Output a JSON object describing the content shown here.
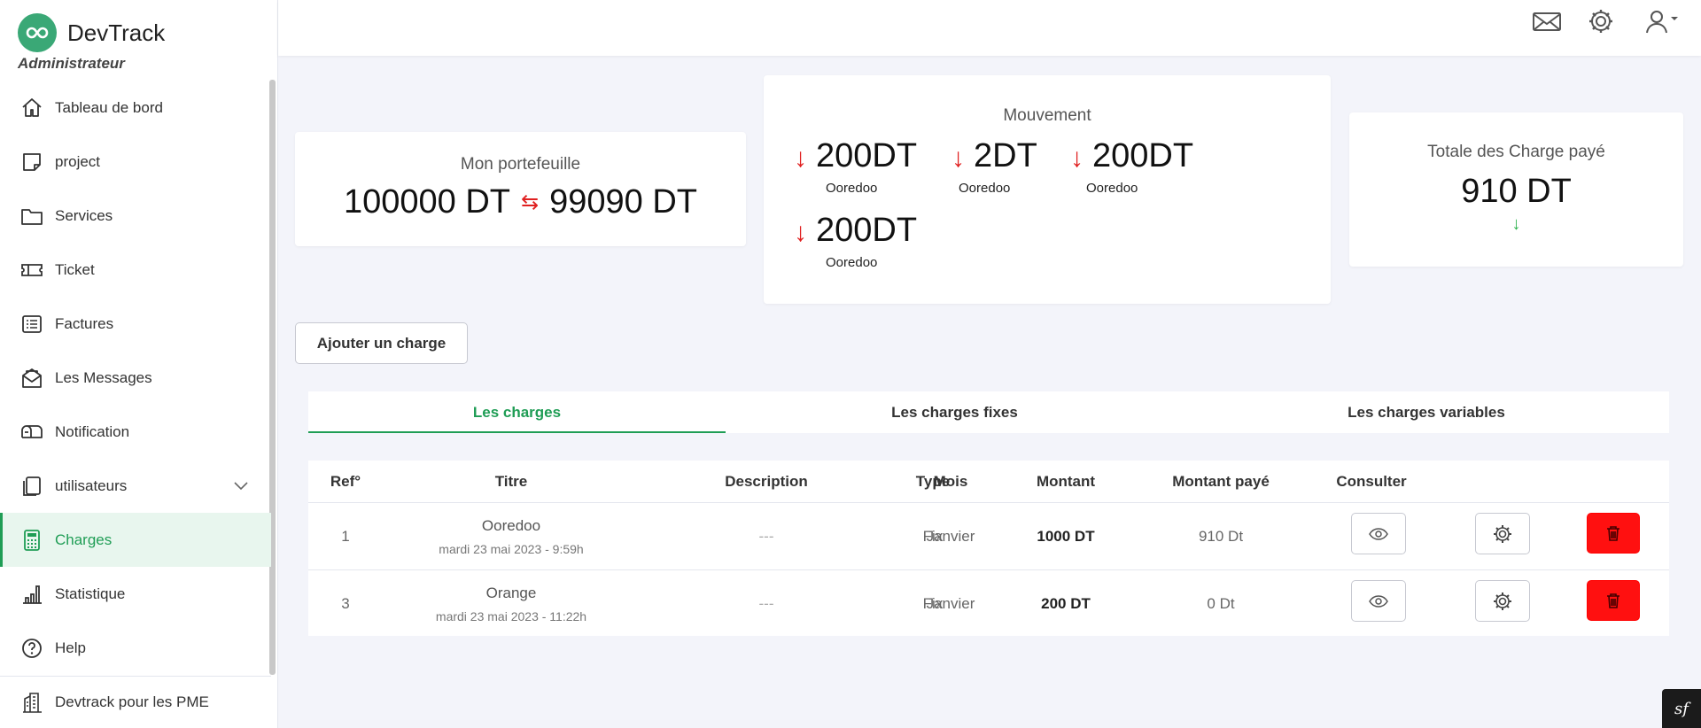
{
  "app": {
    "name": "DevTrack",
    "role": "Administrateur"
  },
  "sidebar": {
    "items": [
      {
        "label": "Tableau de bord",
        "icon": "home-icon"
      },
      {
        "label": "project",
        "icon": "sticky-note-icon"
      },
      {
        "label": "Services",
        "icon": "folder-icon"
      },
      {
        "label": "Ticket",
        "icon": "ticket-icon"
      },
      {
        "label": "Factures",
        "icon": "list-icon"
      },
      {
        "label": "Les Messages",
        "icon": "envelope-open-icon"
      },
      {
        "label": "Notification",
        "icon": "mailbox-icon"
      },
      {
        "label": "utilisateurs",
        "icon": "copy-icon",
        "expandable": true
      },
      {
        "label": "Charges",
        "icon": "calculator-icon",
        "active": true
      },
      {
        "label": "Statistique",
        "icon": "bar-chart-icon"
      },
      {
        "label": "Help",
        "icon": "question-circle-icon"
      }
    ],
    "footer": {
      "label": "Devtrack pour les PME",
      "icon": "buildings-icon"
    }
  },
  "topbar": {
    "icons": [
      "envelope-icon",
      "gear-icon",
      "user-icon"
    ]
  },
  "cards": {
    "wallet": {
      "title": "Mon portefeuille",
      "initial": "100000 DT",
      "exchange_symbol": "⇆",
      "current": "99090 DT"
    },
    "movement": {
      "title": "Mouvement",
      "arrow": "↓",
      "items": [
        {
          "amount": "200DT",
          "label": "Ooredoo"
        },
        {
          "amount": "2DT",
          "label": "Ooredoo"
        },
        {
          "amount": "200DT",
          "label": "Ooredoo"
        },
        {
          "amount": "200DT",
          "label": "Ooredoo"
        }
      ]
    },
    "total": {
      "title": "Totale des Charge payé",
      "value": "910 DT",
      "arrow": "↓"
    }
  },
  "add_button": "Ajouter un charge",
  "tabs": [
    {
      "label": "Les charges",
      "active": true
    },
    {
      "label": "Les charges fixes"
    },
    {
      "label": "Les charges variables"
    }
  ],
  "table": {
    "headers": [
      "Ref°",
      "Titre",
      "Description",
      "Type",
      "Mois",
      "Montant",
      "Montant payé",
      "Consulter"
    ],
    "rows": [
      {
        "ref": "1",
        "title": "Ooredoo",
        "date": "mardi 23 mai 2023 - 9:59h",
        "description": "---",
        "type": "Fix",
        "month": "Janvier",
        "amount": "1000 DT",
        "paid": "910 Dt"
      },
      {
        "ref": "3",
        "title": "Orange",
        "date": "mardi 23 mai 2023 - 11:22h",
        "description": "---",
        "type": "Fix",
        "month": "Janvier",
        "amount": "200 DT",
        "paid": "0 Dt"
      }
    ]
  },
  "colors": {
    "accent": "#1f9d55",
    "danger": "#ff1010",
    "logo": "#3aa876",
    "down_arrow": "#e02020",
    "up_arrow": "#2bb24c"
  },
  "corner_badge": "sf"
}
